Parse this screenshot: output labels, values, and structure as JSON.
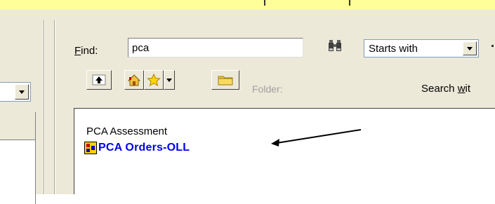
{
  "find": {
    "label_underlined": "F",
    "label_rest": "ind:",
    "value": "pca"
  },
  "match_mode": {
    "selected": "Starts with"
  },
  "toolbar": {
    "folder_label": "Folder:"
  },
  "search": {
    "label_prefix": "Search ",
    "label_underlined": "w",
    "label_suffix": "it"
  },
  "results": {
    "items": [
      {
        "label": "PCA Assessment",
        "style": "plain"
      },
      {
        "label": "PCA Orders-OLL",
        "style": "bold-link",
        "icon": "order-set-icon"
      }
    ]
  },
  "colors": {
    "top_strip": "#ffff99",
    "panel": "#ece9d8",
    "link": "#0000ee"
  }
}
